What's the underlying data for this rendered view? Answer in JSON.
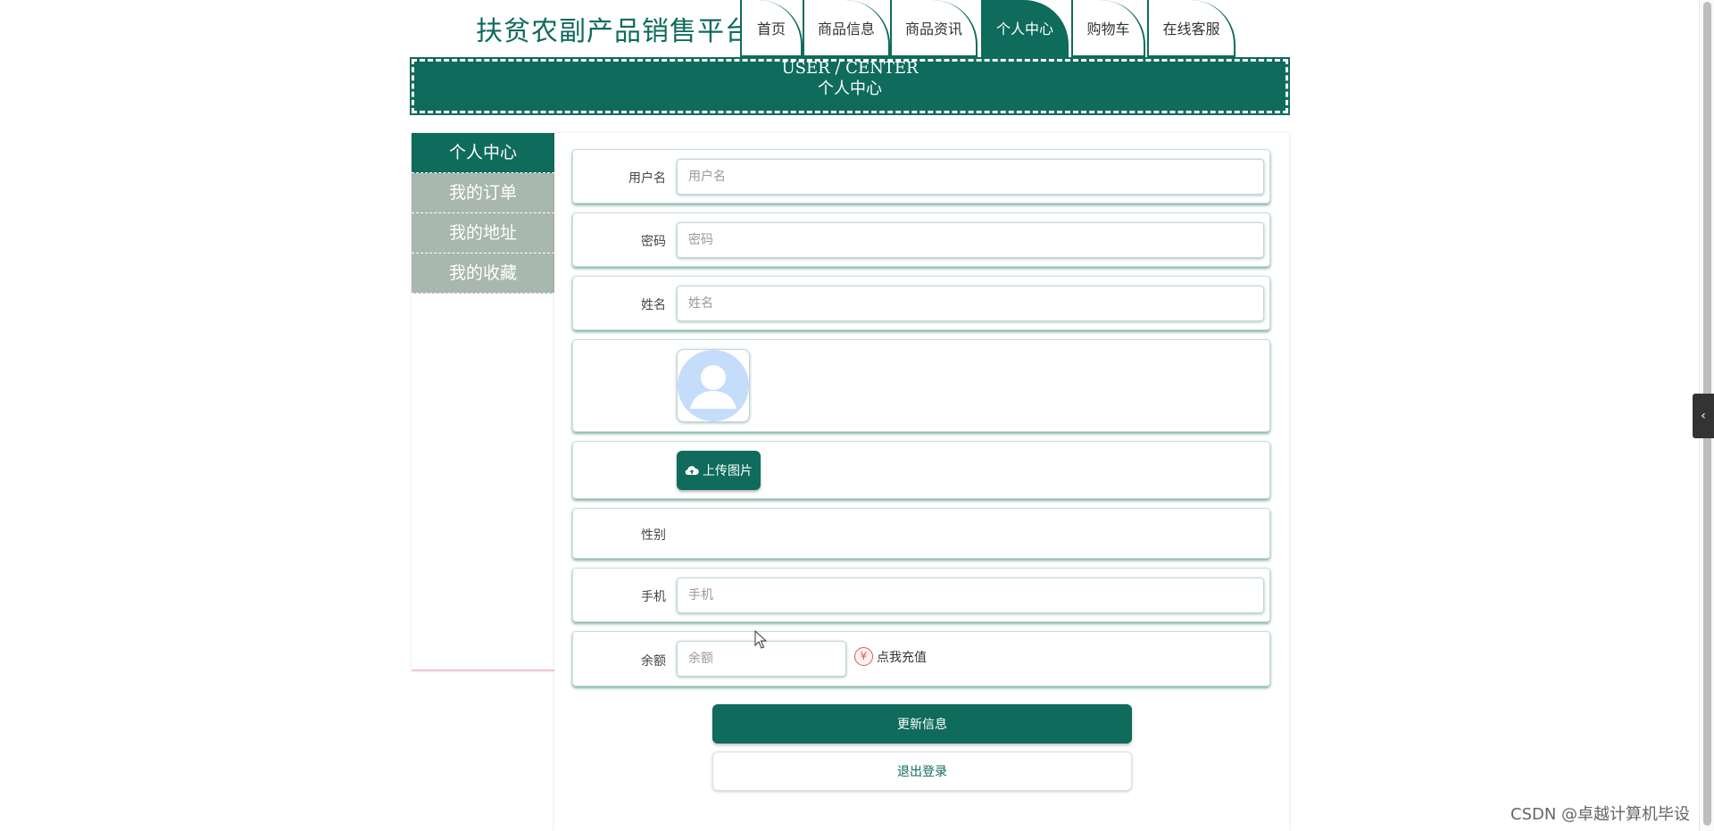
{
  "site": {
    "title": "扶贫农副产品销售平台"
  },
  "nav": {
    "tabs": [
      {
        "label": "首页"
      },
      {
        "label": "商品信息"
      },
      {
        "label": "商品资讯"
      },
      {
        "label": "个人中心",
        "active": true
      },
      {
        "label": "购物车"
      },
      {
        "label": "在线客服"
      }
    ]
  },
  "banner": {
    "en": "USER / CENTER",
    "cn": "个人中心"
  },
  "sidebar": {
    "items": [
      {
        "label": "个人中心",
        "active": true
      },
      {
        "label": "我的订单"
      },
      {
        "label": "我的地址"
      },
      {
        "label": "我的收藏"
      }
    ]
  },
  "form": {
    "username": {
      "label": "用户名",
      "placeholder": "用户名",
      "value": ""
    },
    "password": {
      "label": "密码",
      "placeholder": "密码",
      "value": ""
    },
    "name": {
      "label": "姓名",
      "placeholder": "姓名",
      "value": ""
    },
    "avatar": {
      "icon": "user-avatar-placeholder"
    },
    "upload": {
      "label": "上传图片",
      "icon": "cloud-upload-icon"
    },
    "gender": {
      "label": "性别"
    },
    "phone": {
      "label": "手机",
      "placeholder": "手机",
      "value": ""
    },
    "balance": {
      "label": "余额",
      "placeholder": "余额",
      "value": ""
    },
    "recharge": {
      "label": "点我充值",
      "icon": "yen-icon"
    }
  },
  "actions": {
    "update": "更新信息",
    "logout": "退出登录"
  },
  "watermark": "CSDN @卓越计算机毕设",
  "colors": {
    "primary": "#0f6b5c",
    "sidebar_inactive": "#a8b8ae"
  }
}
